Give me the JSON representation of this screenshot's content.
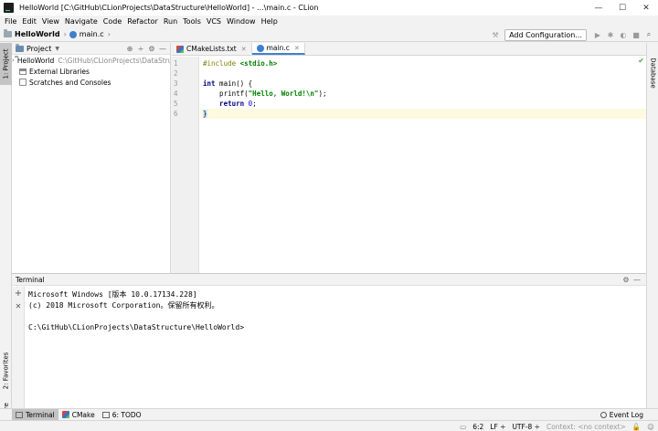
{
  "window": {
    "title": "HelloWorld [C:\\GitHub\\CLionProjects\\DataStructure\\HelloWorld] - ...\\main.c - CLion",
    "minimize": "—",
    "maximize": "☐",
    "close": "✕"
  },
  "menu": [
    "File",
    "Edit",
    "View",
    "Navigate",
    "Code",
    "Refactor",
    "Run",
    "Tools",
    "VCS",
    "Window",
    "Help"
  ],
  "nav": {
    "project": "HelloWorld",
    "file": "main.c",
    "add_config": "Add Configuration..."
  },
  "left_tabs": {
    "project": "1: Project",
    "favorites": "2: Favorites",
    "structure": "Z: Structure"
  },
  "right_tabs": {
    "database": "Database"
  },
  "project_panel": {
    "title": "Project",
    "tree": [
      {
        "name": "HelloWorld",
        "path": "C:\\GitHub\\CLionProjects\\DataStructure\\HelloWorld"
      },
      {
        "name": "External Libraries"
      },
      {
        "name": "Scratches and Consoles"
      }
    ]
  },
  "editor": {
    "tabs": [
      {
        "label": "CMakeLists.txt"
      },
      {
        "label": "main.c"
      }
    ],
    "line_numbers": [
      "1",
      "2",
      "3",
      "4",
      "5",
      "6"
    ],
    "code": {
      "l1_pp": "#include",
      "l1_hdr": "<stdio.h>",
      "l3_kw": "int",
      "l3_rest": " main() {",
      "l4_fn": "    printf(",
      "l4_str": "\"Hello, World!\\n\"",
      "l4_end": ");",
      "l5_kw": "    return",
      "l5_num": "0",
      "l5_end": ";",
      "l6": "}"
    }
  },
  "terminal": {
    "title": "Terminal",
    "lines": [
      "Microsoft Windows [版本 10.0.17134.228]",
      "(c) 2018 Microsoft Corporation。保留所有权利。",
      "",
      "C:\\GitHub\\CLionProjects\\DataStructure\\HelloWorld>"
    ]
  },
  "bottom_tabs": {
    "terminal": "Terminal",
    "cmake": "CMake",
    "todo": "6: TODO",
    "event_log": "Event Log"
  },
  "status": {
    "position": "6:2",
    "line_sep": "LF ÷",
    "encoding": "UTF-8 ÷",
    "context": "Context: <no context>"
  }
}
